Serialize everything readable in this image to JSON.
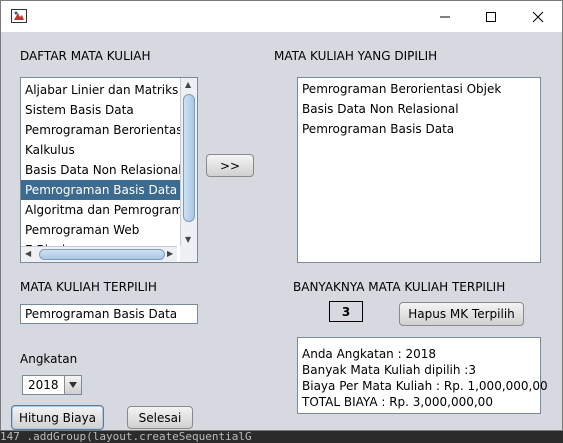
{
  "titlebar": {
    "minimize": "—",
    "maximize": "☐",
    "close": "✕"
  },
  "left": {
    "heading": "DAFTAR MATA KULIAH",
    "items": [
      "Aljabar Linier dan Matriks",
      "Sistem Basis Data",
      "Pemrograman Berorientasi",
      "Kalkulus",
      "Basis Data Non Relasional",
      "Pemrograman Basis Data",
      "Algoritma dan Pemrograma",
      "Pemrograman Web",
      "E-Bisnis"
    ],
    "selected_index": 5
  },
  "move_button": ">>",
  "right": {
    "heading": "MATA KULIAH YANG DIPILIH",
    "items": [
      "Pemrograman Berorientasi Objek",
      "Basis Data Non Relasional",
      "Pemrograman Basis Data"
    ]
  },
  "selected": {
    "label": "MATA KULIAH TERPILIH",
    "value": "Pemrograman Basis Data"
  },
  "count": {
    "label": "BANYAKNYA MATA KULIAH TERPILIH",
    "value": "3"
  },
  "clear_button": "Hapus MK Terpilih",
  "angkatan": {
    "label": "Angkatan",
    "value": "2018"
  },
  "output": [
    "Anda Angkatan : 2018",
    "Banyak Mata Kuliah dipilih :3",
    "Biaya Per Mata Kuliah : Rp. 1,000,000,00",
    "TOTAL BIAYA : Rp. 3,000,000,00"
  ],
  "hitung_button": "Hitung Biaya",
  "selesai_button": "Selesai",
  "code_strip": "147            .addGroup(layout.createSequentialG"
}
